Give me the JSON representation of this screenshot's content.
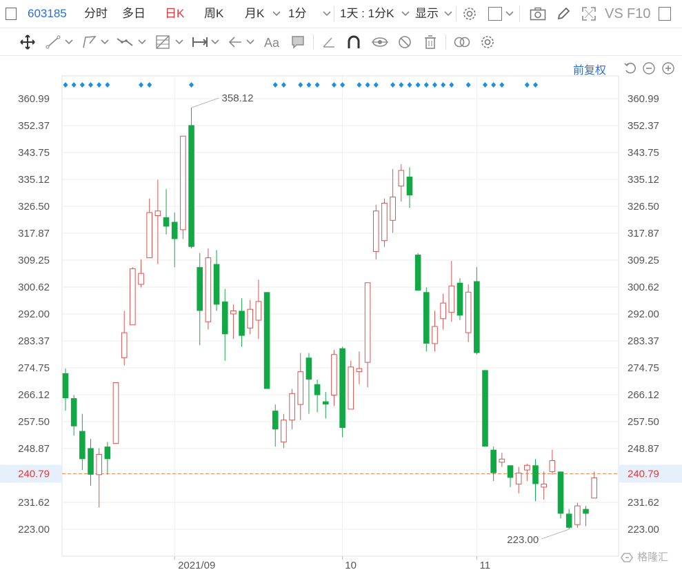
{
  "toolbar": {
    "code": "603185",
    "tabs": [
      "分时",
      "多日",
      "日K",
      "周K",
      "月K",
      "1分"
    ],
    "active_tab": "日K",
    "period_select": "1天 : 1分K",
    "display_label": "显示",
    "vs_label": "VS",
    "f10_label": "F10"
  },
  "chart_header": {
    "adjust_label": "前复权"
  },
  "chart_data": {
    "type": "candlestick",
    "y_ticks": [
      "360.99",
      "352.37",
      "343.75",
      "335.12",
      "326.50",
      "317.87",
      "309.25",
      "300.62",
      "292.00",
      "283.37",
      "274.75",
      "266.12",
      "257.50",
      "248.87",
      "240.79",
      "231.62",
      "223.00"
    ],
    "ylim": [
      219.0,
      365.0
    ],
    "x_ticks": [
      {
        "label": "2021/09",
        "index": 13
      },
      {
        "label": "10",
        "index": 33
      },
      {
        "label": "11",
        "index": 49
      }
    ],
    "current_price": "240.79",
    "max_label": "358.12",
    "min_label": "223.00",
    "up_color": "#d9534f",
    "down_color": "#12a845",
    "candles": [
      {
        "o": 273.0,
        "c": 265.0,
        "h": 274.5,
        "l": 261.0
      },
      {
        "o": 265.0,
        "c": 256.0,
        "h": 266.0,
        "l": 253.0
      },
      {
        "o": 254.5,
        "c": 245.5,
        "h": 260.0,
        "l": 242.0
      },
      {
        "o": 249.0,
        "c": 240.5,
        "h": 252.0,
        "l": 237.0
      },
      {
        "o": 240.5,
        "c": 247.0,
        "h": 249.0,
        "l": 230.0
      },
      {
        "o": 249.5,
        "c": 245.5,
        "h": 251.0,
        "l": 240.5
      },
      {
        "o": 250.5,
        "c": 270.0,
        "h": 270.0,
        "l": 250.5
      },
      {
        "o": 278.0,
        "c": 286.0,
        "h": 293.0,
        "l": 275.5
      },
      {
        "o": 288.5,
        "c": 306.5,
        "h": 307.0,
        "l": 288.5
      },
      {
        "o": 301.5,
        "c": 305.0,
        "h": 309.5,
        "l": 300.5
      },
      {
        "o": 310.0,
        "c": 324.5,
        "h": 329.0,
        "l": 310.0
      },
      {
        "o": 323.5,
        "c": 325.0,
        "h": 335.0,
        "l": 308.0
      },
      {
        "o": 323.0,
        "c": 320.0,
        "h": 332.0,
        "l": 317.5
      },
      {
        "o": 321.5,
        "c": 316.0,
        "h": 324.5,
        "l": 307.0
      },
      {
        "o": 319.0,
        "c": 349.0,
        "h": 349.0,
        "l": 316.0
      },
      {
        "o": 352.5,
        "c": 313.5,
        "h": 358.12,
        "l": 313.0
      },
      {
        "o": 307.0,
        "c": 293.0,
        "h": 311.5,
        "l": 282.0
      },
      {
        "o": 289.5,
        "c": 310.0,
        "h": 313.0,
        "l": 287.0
      },
      {
        "o": 308.0,
        "c": 295.0,
        "h": 312.5,
        "l": 293.0
      },
      {
        "o": 296.0,
        "c": 285.5,
        "h": 300.0,
        "l": 277.0
      },
      {
        "o": 292.0,
        "c": 293.0,
        "h": 295.0,
        "l": 284.0
      },
      {
        "o": 293.0,
        "c": 285.0,
        "h": 297.0,
        "l": 281.5
      },
      {
        "o": 287.5,
        "c": 293.5,
        "h": 296.5,
        "l": 285.5
      },
      {
        "o": 290.0,
        "c": 296.0,
        "h": 303.0,
        "l": 284.0
      },
      {
        "o": 299.0,
        "c": 268.0,
        "h": 299.0,
        "l": 268.0
      },
      {
        "o": 261.0,
        "c": 255.0,
        "h": 263.0,
        "l": 249.5
      },
      {
        "o": 251.0,
        "c": 258.0,
        "h": 260.0,
        "l": 249.0
      },
      {
        "o": 258.0,
        "c": 266.5,
        "h": 268.0,
        "l": 255.0
      },
      {
        "o": 263.0,
        "c": 273.5,
        "h": 279.5,
        "l": 258.0
      },
      {
        "o": 278.0,
        "c": 271.0,
        "h": 279.5,
        "l": 260.0
      },
      {
        "o": 269.5,
        "c": 266.0,
        "h": 271.0,
        "l": 260.5
      },
      {
        "o": 264.0,
        "c": 263.0,
        "h": 267.0,
        "l": 258.5
      },
      {
        "o": 266.0,
        "c": 279.0,
        "h": 280.5,
        "l": 262.5
      },
      {
        "o": 281.0,
        "c": 255.5,
        "h": 281.5,
        "l": 252.5
      },
      {
        "o": 261.5,
        "c": 275.0,
        "h": 277.0,
        "l": 261.5
      },
      {
        "o": 273.5,
        "c": 274.5,
        "h": 280.0,
        "l": 269.5
      },
      {
        "o": 276.5,
        "c": 302.0,
        "h": 302.0,
        "l": 268.5
      },
      {
        "o": 312.0,
        "c": 325.0,
        "h": 327.0,
        "l": 309.5
      },
      {
        "o": 315.5,
        "c": 327.5,
        "h": 329.0,
        "l": 313.5
      },
      {
        "o": 322.0,
        "c": 329.5,
        "h": 338.5,
        "l": 318.0
      },
      {
        "o": 333.0,
        "c": 338.0,
        "h": 340.0,
        "l": 328.0
      },
      {
        "o": 336.0,
        "c": 330.0,
        "h": 339.0,
        "l": 326.0
      },
      {
        "o": 311.0,
        "c": 299.5,
        "h": 311.5,
        "l": 299.5
      },
      {
        "o": 299.0,
        "c": 282.5,
        "h": 300.5,
        "l": 280.0
      },
      {
        "o": 282.5,
        "c": 288.0,
        "h": 293.0,
        "l": 280.0
      },
      {
        "o": 290.5,
        "c": 295.5,
        "h": 298.5,
        "l": 287.0
      },
      {
        "o": 292.5,
        "c": 301.0,
        "h": 309.0,
        "l": 289.5
      },
      {
        "o": 302.0,
        "c": 291.5,
        "h": 303.5,
        "l": 290.0
      },
      {
        "o": 286.0,
        "c": 299.0,
        "h": 301.5,
        "l": 283.0
      },
      {
        "o": 302.5,
        "c": 279.5,
        "h": 307.0,
        "l": 279.0
      },
      {
        "o": 274.0,
        "c": 249.5,
        "h": 274.0,
        "l": 249.5
      },
      {
        "o": 248.5,
        "c": 241.0,
        "h": 249.5,
        "l": 238.5
      },
      {
        "o": 244.5,
        "c": 245.5,
        "h": 247.5,
        "l": 243.0
      },
      {
        "o": 243.5,
        "c": 239.5,
        "h": 243.5,
        "l": 236.5
      },
      {
        "o": 237.5,
        "c": 241.0,
        "h": 243.0,
        "l": 234.5
      },
      {
        "o": 242.0,
        "c": 243.5,
        "h": 244.0,
        "l": 238.5
      },
      {
        "o": 243.5,
        "c": 237.5,
        "h": 245.5,
        "l": 232.0
      },
      {
        "o": 236.5,
        "c": 237.5,
        "h": 241.5,
        "l": 232.5
      },
      {
        "o": 241.5,
        "c": 245.0,
        "h": 248.5,
        "l": 240.5
      },
      {
        "o": 241.5,
        "c": 228.0,
        "h": 241.5,
        "l": 226.5
      },
      {
        "o": 228.0,
        "c": 223.5,
        "h": 229.5,
        "l": 223.0
      },
      {
        "o": 224.5,
        "c": 230.5,
        "h": 231.5,
        "l": 223.5
      },
      {
        "o": 229.5,
        "c": 228.0,
        "h": 230.5,
        "l": 224.0
      },
      {
        "o": 233.0,
        "c": 239.5,
        "h": 241.5,
        "l": 233.0
      }
    ],
    "marker_groups": [
      [
        0,
        5
      ],
      [
        9,
        10
      ],
      [
        15,
        15
      ],
      [
        25,
        26
      ],
      [
        28,
        30
      ],
      [
        32,
        33
      ],
      [
        35,
        37
      ],
      [
        39,
        43
      ],
      [
        44,
        46
      ],
      [
        48,
        48
      ],
      [
        50,
        52
      ],
      [
        55,
        56
      ]
    ],
    "grid": true
  },
  "colors": {
    "accent": "#2a6fd6",
    "active_tab": "#e4393c",
    "price_line": "#e88a5a",
    "price_band": "#e5f0fb",
    "grid": "#eeeeee",
    "axis_text": "#555555"
  },
  "icons": [
    "window-icon",
    "chevron-down-icon",
    "gear-icon",
    "square-icon",
    "camera-icon",
    "pen-icon",
    "fullscreen-icon",
    "window-icon",
    "move-icon",
    "line-tool-icon",
    "polyline-tool-icon",
    "wave-tool-icon",
    "fib-tool-icon",
    "range-tool-icon",
    "arrow-left-icon",
    "text-tool-icon",
    "comment-icon",
    "ruler-icon",
    "magnet-icon",
    "eye-off-icon",
    "lock-off-icon",
    "trash-icon",
    "link-icon",
    "settings-icon",
    "undo-icon",
    "zoom-out-icon",
    "zoom-in-icon"
  ],
  "watermark": "格隆汇"
}
